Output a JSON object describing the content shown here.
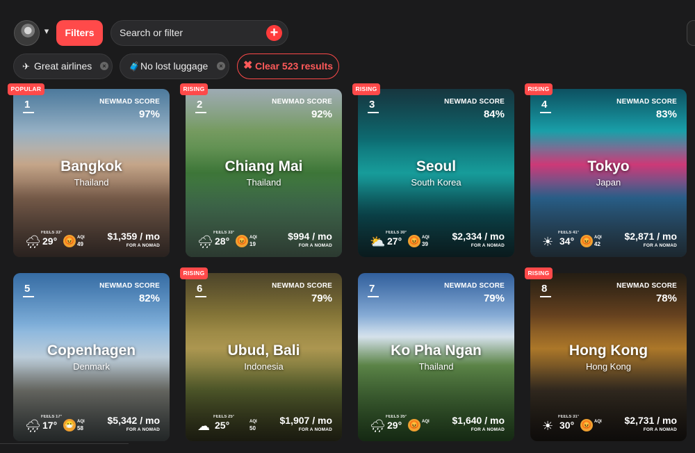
{
  "header": {
    "filters_label": "Filters",
    "search_placeholder": "Search or filter",
    "plus_glyph": "+"
  },
  "chips": [
    {
      "icon": "✈",
      "icon_name": "airplane-icon",
      "label": "Great airlines"
    },
    {
      "icon": "🧳",
      "icon_name": "luggage-icon",
      "label": "No lost luggage"
    }
  ],
  "clear": {
    "icon": "✖",
    "label": "Clear 523 results"
  },
  "score_label": "NEWMAD SCORE",
  "feels_label": "FEELS",
  "aqi_label": "AQI",
  "per_nomad_label": "FOR A NOMAD",
  "cards": [
    {
      "rank": "1",
      "badge": "POPULAR",
      "score": "97%",
      "city": "Bangkok",
      "country": "Thailand",
      "weather": "🌧",
      "feels": "FEELS 33°",
      "temp": "29°",
      "aqi_icon": "😡",
      "aqi": "49",
      "price": "$1,359 / mo"
    },
    {
      "rank": "2",
      "badge": "RISING",
      "score": "92%",
      "city": "Chiang Mai",
      "country": "Thailand",
      "weather": "🌧",
      "feels": "FEELS 33°",
      "temp": "28°",
      "aqi_icon": "😡",
      "aqi": "19",
      "price": "$994 / mo"
    },
    {
      "rank": "3",
      "badge": "RISING",
      "score": "84%",
      "city": "Seoul",
      "country": "South Korea",
      "weather": "⛅",
      "feels": "FEELS 30°",
      "temp": "27°",
      "aqi_icon": "😡",
      "aqi": "39",
      "price": "$2,334 / mo"
    },
    {
      "rank": "4",
      "badge": "RISING",
      "score": "83%",
      "city": "Tokyo",
      "country": "Japan",
      "weather": "☀",
      "feels": "FEELS 41°",
      "temp": "34°",
      "aqi_icon": "😡",
      "aqi": "42",
      "price": "$2,871 / mo"
    },
    {
      "rank": "5",
      "badge": "",
      "score": "82%",
      "city": "Copenhagen",
      "country": "Denmark",
      "weather": "🌧",
      "feels": "FEELS 17°",
      "temp": "17°",
      "aqi_icon": "😷",
      "aqi": "58",
      "price": "$5,342 / mo"
    },
    {
      "rank": "6",
      "badge": "RISING",
      "score": "79%",
      "city": "Ubud, Bali",
      "country": "Indonesia",
      "weather": "☁",
      "feels": "FEELS 25°",
      "temp": "25°",
      "aqi_icon": "",
      "aqi": "50",
      "price": "$1,907 / mo"
    },
    {
      "rank": "7",
      "badge": "",
      "score": "79%",
      "city": "Ko Pha Ngan",
      "country": "Thailand",
      "weather": "🌧",
      "feels": "FEELS 35°",
      "temp": "29°",
      "aqi_icon": "😡",
      "aqi": "",
      "price": "$1,640 / mo"
    },
    {
      "rank": "8",
      "badge": "RISING",
      "score": "78%",
      "city": "Hong Kong",
      "country": "Hong Kong",
      "weather": "☀",
      "feels": "FEELS 31°",
      "temp": "30°",
      "aqi_icon": "😡",
      "aqi": "",
      "price": "$2,731 / mo"
    }
  ]
}
